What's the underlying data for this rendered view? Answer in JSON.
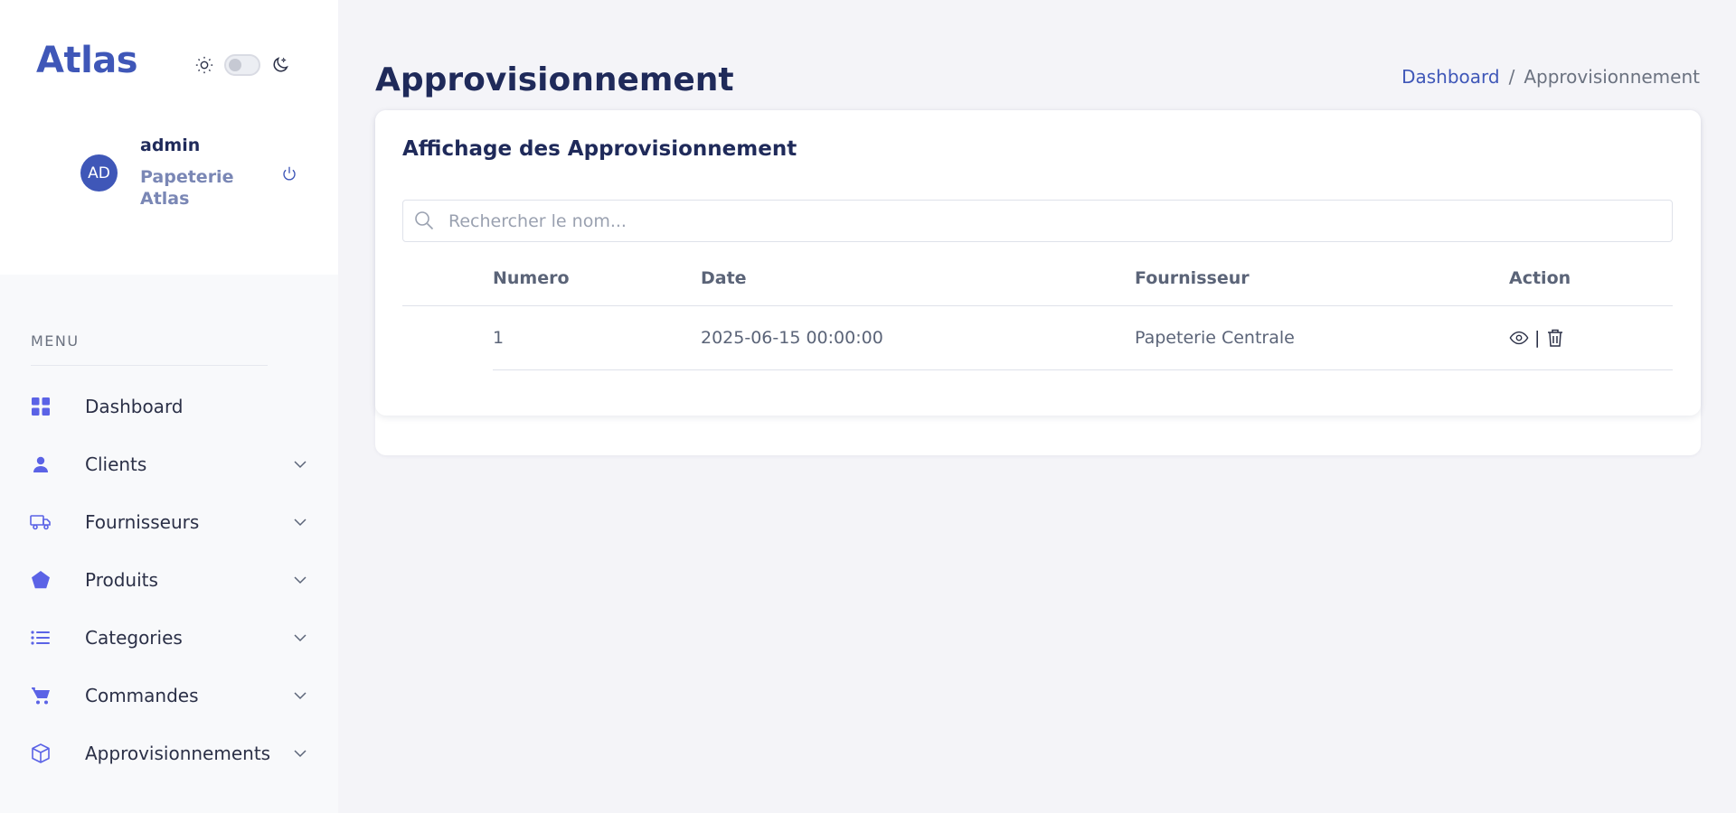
{
  "brand": "Atlas",
  "user": {
    "avatar": "AD",
    "name": "admin",
    "org": "Papeterie Atlas"
  },
  "sidebar": {
    "menu_label": "MENU",
    "items": [
      {
        "label": "Dashboard",
        "icon": "grid-icon",
        "has_children": false
      },
      {
        "label": "Clients",
        "icon": "user-icon",
        "has_children": true
      },
      {
        "label": "Fournisseurs",
        "icon": "truck-icon",
        "has_children": true
      },
      {
        "label": "Produits",
        "icon": "pentagon-icon",
        "has_children": true
      },
      {
        "label": "Categories",
        "icon": "list-icon",
        "has_children": true
      },
      {
        "label": "Commandes",
        "icon": "cart-icon",
        "has_children": true
      },
      {
        "label": "Approvisionnements",
        "icon": "box-icon",
        "has_children": true
      }
    ]
  },
  "page": {
    "title": "Approvisionnement",
    "breadcrumb": {
      "home": "Dashboard",
      "separator": "/",
      "current": "Approvisionnement"
    }
  },
  "card": {
    "title": "Affichage des Approvisionnement",
    "search_placeholder": "Rechercher le nom...",
    "columns": [
      "Numero",
      "Date",
      "Fournisseur",
      "Action"
    ],
    "rows": [
      {
        "numero": "1",
        "date": "2025-06-15 00:00:00",
        "fournisseur": "Papeterie Centrale",
        "action_sep": "|"
      }
    ]
  },
  "colors": {
    "accent": "#3f57b8",
    "icon": "#5b63e6",
    "background": "#f4f4f8"
  }
}
